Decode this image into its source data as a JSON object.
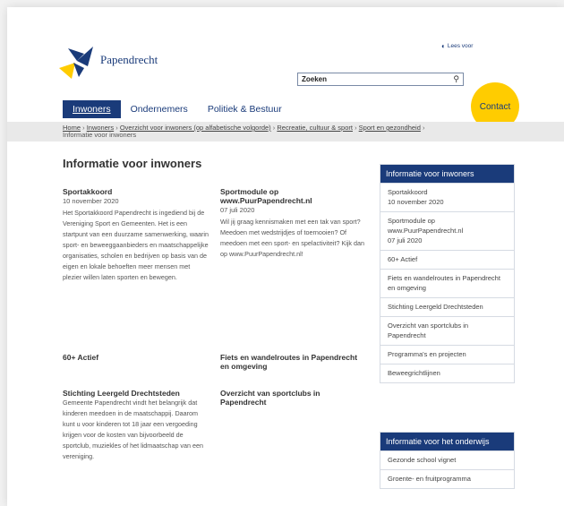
{
  "header": {
    "logo_text": "Papendrecht",
    "lees_voor": "Lees voor",
    "search": {
      "value": "Zoeken"
    },
    "contact": "Contact"
  },
  "nav": [
    {
      "label": "Inwoners",
      "active": true
    },
    {
      "label": "Ondernemers",
      "active": false
    },
    {
      "label": "Politiek & Bestuur",
      "active": false
    }
  ],
  "breadcrumb": {
    "links": [
      "Home",
      "Inwoners",
      "Overzicht voor inwoners (op alfabetische volgorde)",
      "Recreatie, cultuur & sport",
      "Sport en gezondheid"
    ],
    "current": "Informatie voor inwoners"
  },
  "main": {
    "title": "Informatie voor inwoners",
    "items": [
      {
        "title": "Sportakkoord",
        "date": "10 november 2020",
        "text": "Het Sportakkoord Papendrecht is ingediend bij de Vereniging Sport en Gemeenten. Het is een startpunt van een duurzame samenwerking, waarin sport- en beweeggaanbieders en maatschappelijke organisaties, scholen en bedrijven op basis van de eigen en lokale behoeften meer mensen met plezier willen laten sporten en bewegen."
      },
      {
        "title": "Sportmodule op www.PuurPapendrecht.nl",
        "date": "07 juli 2020",
        "text": "Wil jij graag kennismaken met een tak van sport? Meedoen met wedstrijdjes of toernooien? Of meedoen met een sport- en spelactiviteit? Kijk dan op www.PuurPapendrecht.nl!"
      },
      {
        "title": "60+ Actief",
        "date": "",
        "text": ""
      },
      {
        "title": "Fiets en wandelroutes in Papendrecht en omgeving",
        "date": "",
        "text": ""
      },
      {
        "title": "Stichting Leergeld Drechtsteden",
        "date": "",
        "text": "Gemeente Papendrecht vindt het belangrijk dat kinderen meedoen in de maatschappij. Daarom kunt u voor kinderen tot 18 jaar een vergoeding krijgen voor de kosten van bijvoorbeeld de sportclub, muziekles of het lidmaatschap van een vereniging."
      },
      {
        "title": "Overzicht van sportclubs in Papendrecht",
        "date": "",
        "text": ""
      }
    ]
  },
  "sidebar1": {
    "title": "Informatie voor inwoners",
    "items": [
      "Sportakkoord",
      "10 november 2020",
      "Sportmodule op www.PuurPapendrecht.nl",
      "07 juli 2020",
      "60+ Actief",
      "Fiets en wandelroutes in Papendrecht en omgeving",
      "Stichting Leergeld Drechtsteden",
      "Overzicht van sportclubs in Papendrecht",
      "Programma's en projecten",
      "Beweegrichtlijnen"
    ]
  },
  "sidebar2": {
    "title": "Informatie voor het onderwijs",
    "items": [
      "Gezonde school vignet",
      "Groente- en fruitprogramma"
    ]
  },
  "colors": {
    "brand_blue": "#1a3b7a",
    "contact_yellow": "#ffcc00"
  }
}
